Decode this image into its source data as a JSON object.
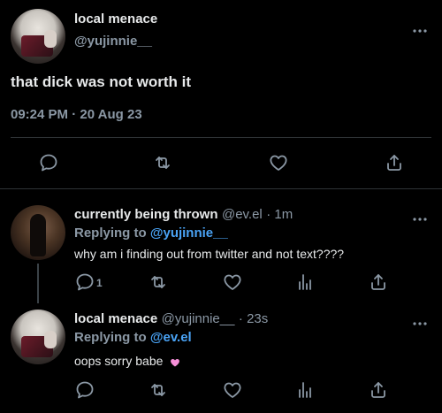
{
  "main_tweet": {
    "display_name": "local menace",
    "handle": "@yujinnie__",
    "text": "that dick was not worth it",
    "timestamp": "09:24 PM · 20 Aug 23",
    "more_icon": "more-horizontal-icon",
    "actions": [
      {
        "icon": "reply-icon"
      },
      {
        "icon": "retweet-icon"
      },
      {
        "icon": "like-icon"
      },
      {
        "icon": "share-icon"
      }
    ]
  },
  "replies": [
    {
      "display_name": "currently being thrown",
      "handle": "@ev.el",
      "time": "· 1m",
      "replying_prefix": "Replying to",
      "replying_to": "@yujinnie__",
      "text": "why am i finding out from twitter and not text????",
      "reply_count": "1"
    },
    {
      "display_name": "local menace",
      "handle": "@yujinnie__",
      "time": "· 23s",
      "replying_prefix": "Replying to",
      "replying_to": "@ev.el",
      "text": "oops sorry babe",
      "emoji": "💗",
      "reply_count": ""
    }
  ],
  "colors": {
    "background": "#000000",
    "text_primary": "#e7e9ea",
    "text_secondary": "#8b98a5",
    "mention": "#4aa3f5",
    "divider": "#2f3336",
    "emoji_heart": "#f78fd8"
  }
}
